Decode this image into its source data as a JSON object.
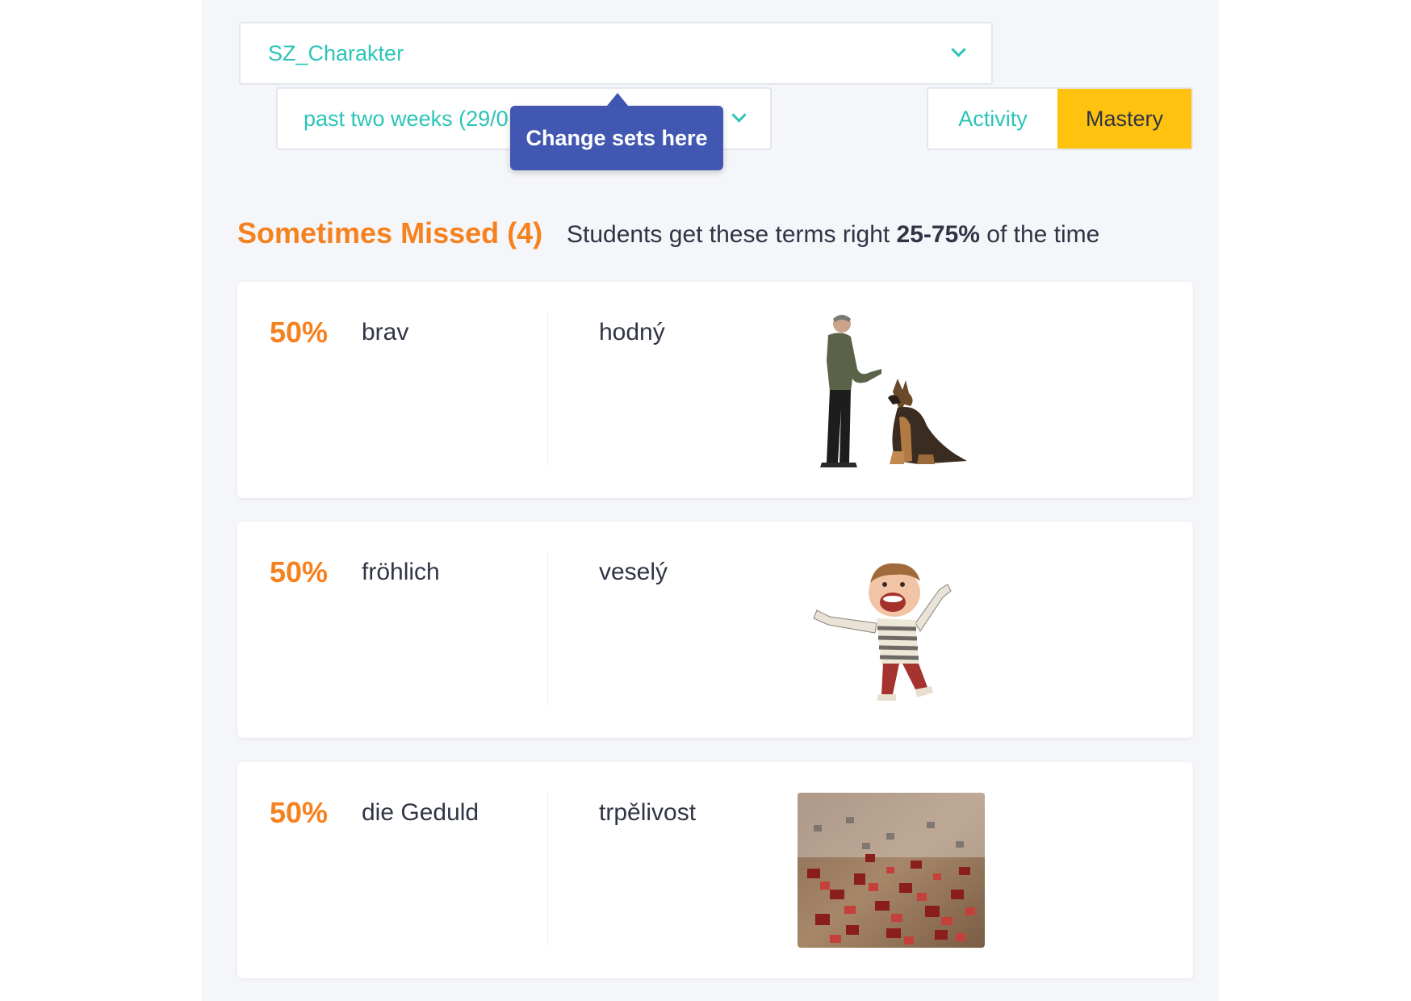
{
  "filters": {
    "set_label": "SZ_Charakter",
    "date_label": "past two weeks (29/0",
    "tooltip": "Change sets here"
  },
  "view_toggle": {
    "activity": "Activity",
    "mastery": "Mastery",
    "selected": "Mastery"
  },
  "section": {
    "title": "Sometimes Missed (4)",
    "desc_prefix": "Students get these terms right ",
    "desc_range": "25-75%",
    "desc_suffix": " of the time"
  },
  "terms": [
    {
      "percent": "50%",
      "term": "brav",
      "definition": "hodný",
      "image": "man-training-dog-image"
    },
    {
      "percent": "50%",
      "term": "fröhlich",
      "definition": "veselý",
      "image": "happy-cartoon-boy-image"
    },
    {
      "percent": "50%",
      "term": "die Geduld",
      "definition": "trpělivost",
      "image": "jigsaw-puzzle-pieces-image"
    }
  ],
  "colors": {
    "accent_teal": "#2cc4b8",
    "accent_orange": "#f5811f",
    "toggle_active": "#ffc20e",
    "tooltip_bg": "#4257b2"
  }
}
